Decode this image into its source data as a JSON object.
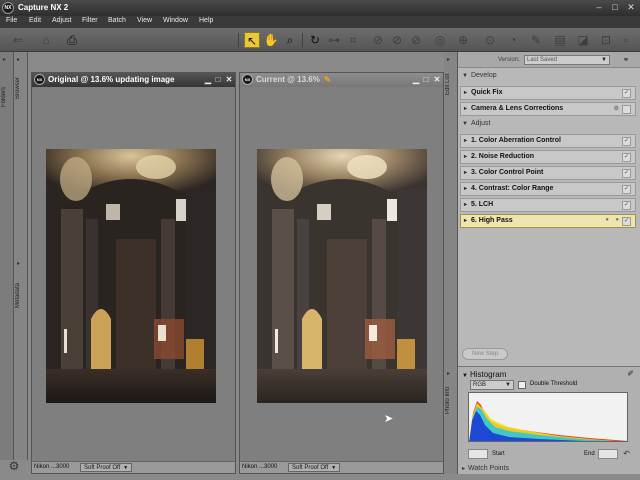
{
  "app": {
    "logo_text": "NX",
    "title": "Capture NX 2"
  },
  "window_controls": {
    "minimize": "–",
    "maximize": "□",
    "close": "✕"
  },
  "menu": [
    "File",
    "Edit",
    "Adjust",
    "Filter",
    "Batch",
    "View",
    "Window",
    "Help"
  ],
  "toolbar": {
    "icons": [
      "back-icon",
      "camera-icon",
      "inbox-icon",
      "select-arrow-icon",
      "hand-icon",
      "zoom-icon",
      "rotate-icon",
      "straighten-icon",
      "crop-icon",
      "red-eye-icon",
      "auto-retouch-icon",
      "lasso-icon",
      "color-control-point-icon",
      "black-point-icon",
      "white-point-icon",
      "neutral-point-icon",
      "brush-icon",
      "gradient-icon",
      "fill-icon",
      "fit-icon"
    ]
  },
  "left_strip": {
    "folders_tab": "Folders",
    "browser_tab": "Browser",
    "metadata_tab": "Metadata"
  },
  "windows": {
    "original": {
      "logo": "NX",
      "title": "Original @ 13.6% updating image",
      "status_camera": "Nikon ...3000",
      "status_proof": "Soft Proof Off"
    },
    "current": {
      "logo": "NX",
      "title": "Current @ 13.6%",
      "status_camera": "Nikon ...3000",
      "status_proof": "Soft Proof Off"
    }
  },
  "right_strip": {
    "edit_list_tab": "Edit List",
    "photo_info_tab": "Photo Info"
  },
  "edit_panel": {
    "version_label": "Version:",
    "version_value": "Last Saved",
    "develop_title": "Develop",
    "develop_items": [
      {
        "label": "Quick Fix"
      },
      {
        "label": "Camera & Lens Corrections"
      }
    ],
    "adjust_title": "Adjust",
    "adjust_items": [
      {
        "label": "1. Color Aberration Control"
      },
      {
        "label": "2. Noise Reduction"
      },
      {
        "label": "3. Color Control Point"
      },
      {
        "label": "4. Contrast: Color Range"
      },
      {
        "label": "5. LCH"
      },
      {
        "label": "6. High Pass"
      }
    ],
    "selected_step": "6. High Pass",
    "new_step_label": "New Step"
  },
  "histogram": {
    "title": "Histogram",
    "channel": "RGB",
    "double_threshold_label": "Double Threshold",
    "start_label": "Start",
    "end_label": "End"
  },
  "watch_points": {
    "title": "Watch Points"
  },
  "colors": {
    "selected_row": "#ede4b0",
    "title_bar": "#353535",
    "panel_bg": "#b8b8b8"
  }
}
